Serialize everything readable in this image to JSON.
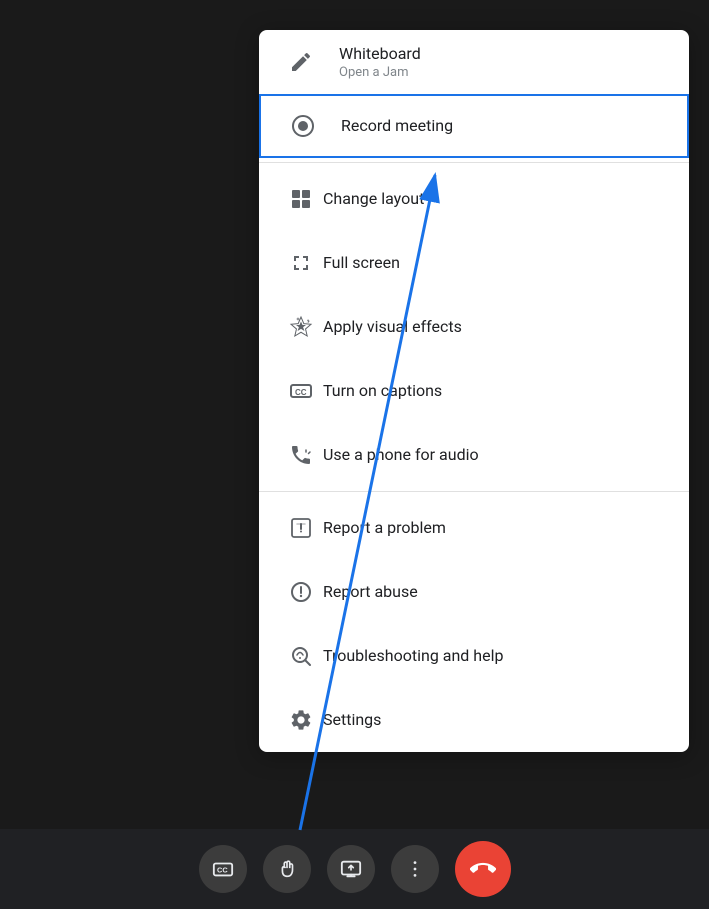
{
  "background_color": "#1a1a1a",
  "toolbar": {
    "buttons": [
      {
        "id": "captions-btn",
        "label": "CC",
        "icon": "cc-icon"
      },
      {
        "id": "raise-hand-btn",
        "label": "Raise hand",
        "icon": "hand-icon"
      },
      {
        "id": "share-btn",
        "label": "Present now",
        "icon": "present-icon"
      },
      {
        "id": "more-btn",
        "label": "More options",
        "icon": "more-icon"
      },
      {
        "id": "end-call-btn",
        "label": "End call",
        "icon": "end-call-icon"
      }
    ]
  },
  "dropdown": {
    "items": [
      {
        "id": "whiteboard",
        "label": "Whiteboard",
        "sublabel": "Open a Jam",
        "icon": "whiteboard-icon",
        "highlighted": false,
        "has_divider_after": false
      },
      {
        "id": "record-meeting",
        "label": "Record meeting",
        "sublabel": "",
        "icon": "record-icon",
        "highlighted": true,
        "has_divider_after": true
      },
      {
        "id": "change-layout",
        "label": "Change layout",
        "sublabel": "",
        "icon": "layout-icon",
        "highlighted": false,
        "has_divider_after": false
      },
      {
        "id": "full-screen",
        "label": "Full screen",
        "sublabel": "",
        "icon": "fullscreen-icon",
        "highlighted": false,
        "has_divider_after": false
      },
      {
        "id": "visual-effects",
        "label": "Apply visual effects",
        "sublabel": "",
        "icon": "effects-icon",
        "highlighted": false,
        "has_divider_after": false
      },
      {
        "id": "captions",
        "label": "Turn on captions",
        "sublabel": "",
        "icon": "captions-icon",
        "highlighted": false,
        "has_divider_after": false
      },
      {
        "id": "phone-audio",
        "label": "Use a phone for audio",
        "sublabel": "",
        "icon": "phone-audio-icon",
        "highlighted": false,
        "has_divider_after": true
      },
      {
        "id": "report-problem",
        "label": "Report a problem",
        "sublabel": "",
        "icon": "report-problem-icon",
        "highlighted": false,
        "has_divider_after": false
      },
      {
        "id": "report-abuse",
        "label": "Report abuse",
        "sublabel": "",
        "icon": "report-abuse-icon",
        "highlighted": false,
        "has_divider_after": false
      },
      {
        "id": "troubleshooting",
        "label": "Troubleshooting and help",
        "sublabel": "",
        "icon": "troubleshooting-icon",
        "highlighted": false,
        "has_divider_after": false
      },
      {
        "id": "settings",
        "label": "Settings",
        "sublabel": "",
        "icon": "settings-icon",
        "highlighted": false,
        "has_divider_after": false
      }
    ]
  },
  "arrow": {
    "color": "#1a73e8",
    "visible": true
  }
}
